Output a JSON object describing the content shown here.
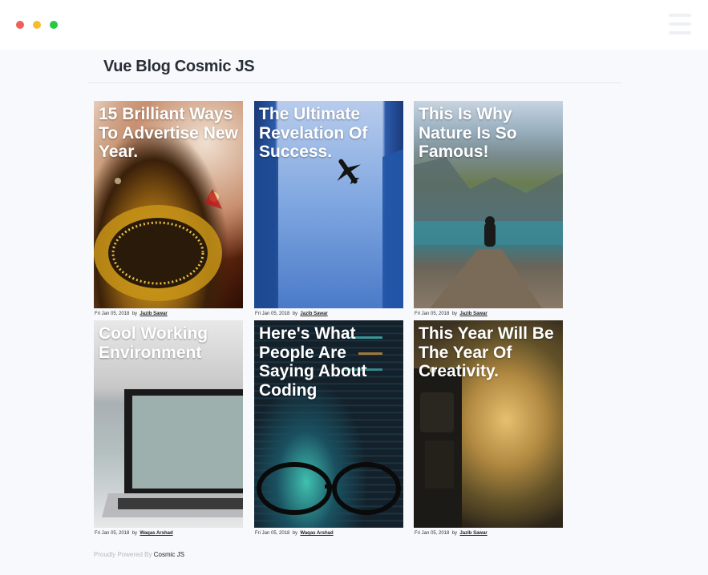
{
  "window": {
    "controls": [
      "close",
      "minimize",
      "maximize"
    ]
  },
  "header": {
    "title": "Vue Blog Cosmic JS",
    "menu_icon": "hamburger-menu-icon"
  },
  "posts": [
    {
      "title": "15 Brilliant Ways To Advertise New Year.",
      "date": "Fri Jan 05, 2018",
      "by": "by",
      "author": "Jazib Sawar",
      "image": "new-year-ornament"
    },
    {
      "title": "The Ultimate Revelation Of Success.",
      "date": "Fri Jan 05, 2018",
      "by": "by",
      "author": "Jazib Sawar",
      "image": "airplane-between-skyscrapers"
    },
    {
      "title": "This Is Why Nature Is So Famous!",
      "date": "Fri Jan 05, 2018",
      "by": "by",
      "author": "Jazib Sawar",
      "image": "person-on-lake-pier"
    },
    {
      "title": "Cool Working Environment",
      "date": "Fri Jan 05, 2018",
      "by": "by",
      "author": "Waqas Arshad",
      "image": "laptop-on-desk"
    },
    {
      "title": "Here's What People Are Saying About Coding",
      "date": "Fri Jan 05, 2018",
      "by": "by",
      "author": "Waqas Arshad",
      "image": "code-screen-glasses"
    },
    {
      "title": "This Year Will Be The Year Of Creativity.",
      "date": "Fri Jan 05, 2018",
      "by": "by",
      "author": "Jazib Sawar",
      "image": "robot-figure"
    }
  ],
  "footer": {
    "text": "Proudly Powered By",
    "link": "Cosmic JS"
  },
  "colors": {
    "background": "#f7f9fc",
    "titlebar": "#ffffff",
    "close": "#f25f57",
    "minimize": "#f5bd2e",
    "maximize": "#28c840",
    "title_text": "#2a2e36"
  }
}
